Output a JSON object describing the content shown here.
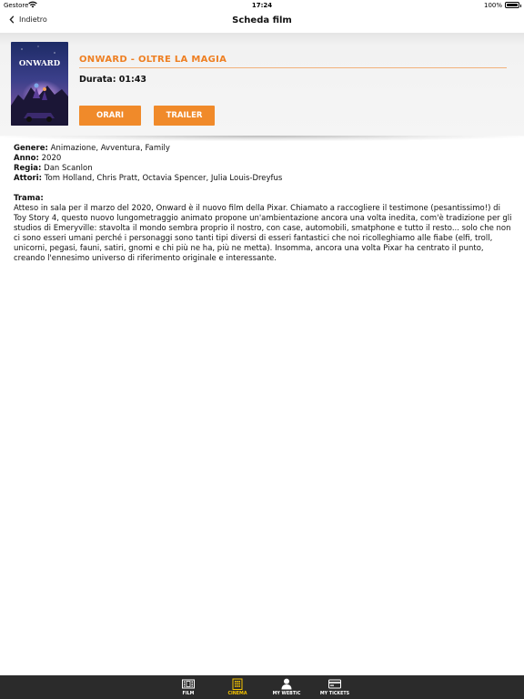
{
  "status_bar": {
    "carrier": "Gestore",
    "time": "17:24",
    "battery": "100%"
  },
  "nav": {
    "back_label": "Indietro",
    "title": "Scheda film"
  },
  "film": {
    "title": "ONWARD - OLTRE LA MAGIA",
    "duration": "Durata: 01:43",
    "poster_text": "ONWARD",
    "buttons": {
      "orari": "ORARI",
      "trailer": "TRAILER"
    }
  },
  "details": {
    "genre_label": "Genere:",
    "genre_value": "Animazione, Avventura, Family",
    "year_label": "Anno:",
    "year_value": "2020",
    "director_label": "Regia:",
    "director_value": "Dan Scanlon",
    "actors_label": "Attori:",
    "actors_value": "Tom Holland, Chris Pratt, Octavia Spencer, Julia Louis-Dreyfus",
    "plot_label": "Trama:",
    "plot_text": "Atteso in sala per il marzo del 2020, Onward è il nuovo film della Pixar. Chiamato a raccogliere il testimone (pesantissimo!) di Toy Story 4, questo nuovo lungometraggio animato propone un'ambientazione ancora una volta inedita, com'è tradizione per gli studios di Emeryville: stavolta il mondo sembra proprio il nostro, con case, automobili, smatphone e tutto il resto... solo che non ci sono esseri umani perché i personaggi sono tanti tipi diversi di esseri fantastici che noi ricolleghiamo alle fiabe (elfi, troll, unicorni, pegasi, fauni, satiri, gnomi e chi più ne ha, più ne metta). Insomma, ancora una volta Pixar ha centrato il punto, creando l'ennesimo universo di riferimento originale e interessante."
  },
  "tabs": [
    {
      "label": "FILM",
      "icon": "film-icon",
      "active": false
    },
    {
      "label": "CINEMA",
      "icon": "cinema-icon",
      "active": true
    },
    {
      "label": "MY WEBTIC",
      "icon": "user-icon",
      "active": false
    },
    {
      "label": "MY TICKETS",
      "icon": "ticket-icon",
      "active": false
    }
  ],
  "colors": {
    "accent": "#f08a2a",
    "title": "#ee7f22",
    "tab_active": "#f5c300",
    "tabbar": "#2b2b2b"
  }
}
